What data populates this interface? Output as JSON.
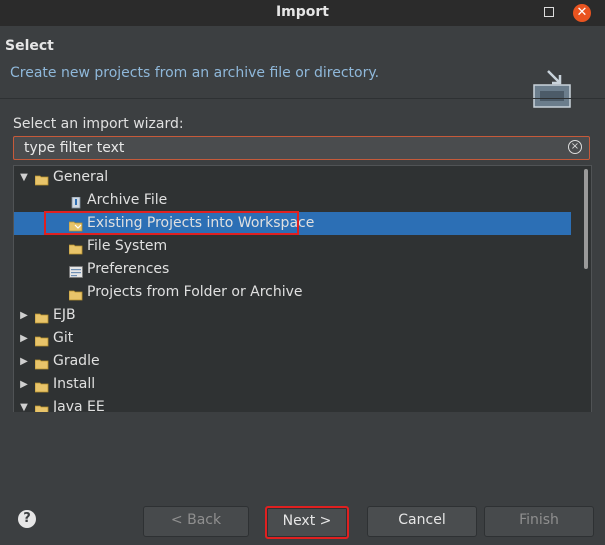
{
  "window": {
    "title": "Import"
  },
  "header": {
    "title": "Select",
    "description": "Create new projects from an archive file or directory."
  },
  "wizard": {
    "label": "Select an import wizard:",
    "filter_placeholder": "type filter text"
  },
  "tree": [
    {
      "label": "General",
      "expanded": true,
      "level": 0
    },
    {
      "label": "Archive File",
      "level": 1,
      "icon": "archive-icon"
    },
    {
      "label": "Existing Projects into Workspace",
      "level": 1,
      "icon": "project-folder-icon",
      "selected": true
    },
    {
      "label": "File System",
      "level": 1,
      "icon": "folder-icon"
    },
    {
      "label": "Preferences",
      "level": 1,
      "icon": "preferences-icon"
    },
    {
      "label": "Projects from Folder or Archive",
      "level": 1,
      "icon": "folder-icon"
    },
    {
      "label": "EJB",
      "expanded": false,
      "level": 0
    },
    {
      "label": "Git",
      "expanded": false,
      "level": 0
    },
    {
      "label": "Gradle",
      "expanded": false,
      "level": 0
    },
    {
      "label": "Install",
      "expanded": false,
      "level": 0
    },
    {
      "label": "Java EE",
      "expanded": true,
      "level": 0
    }
  ],
  "buttons": {
    "back": "< Back",
    "next": "Next >",
    "cancel": "Cancel",
    "finish": "Finish"
  },
  "colors": {
    "selection": "#2c6fb5",
    "annotation": "#e02020",
    "description": "#8fb8da"
  }
}
